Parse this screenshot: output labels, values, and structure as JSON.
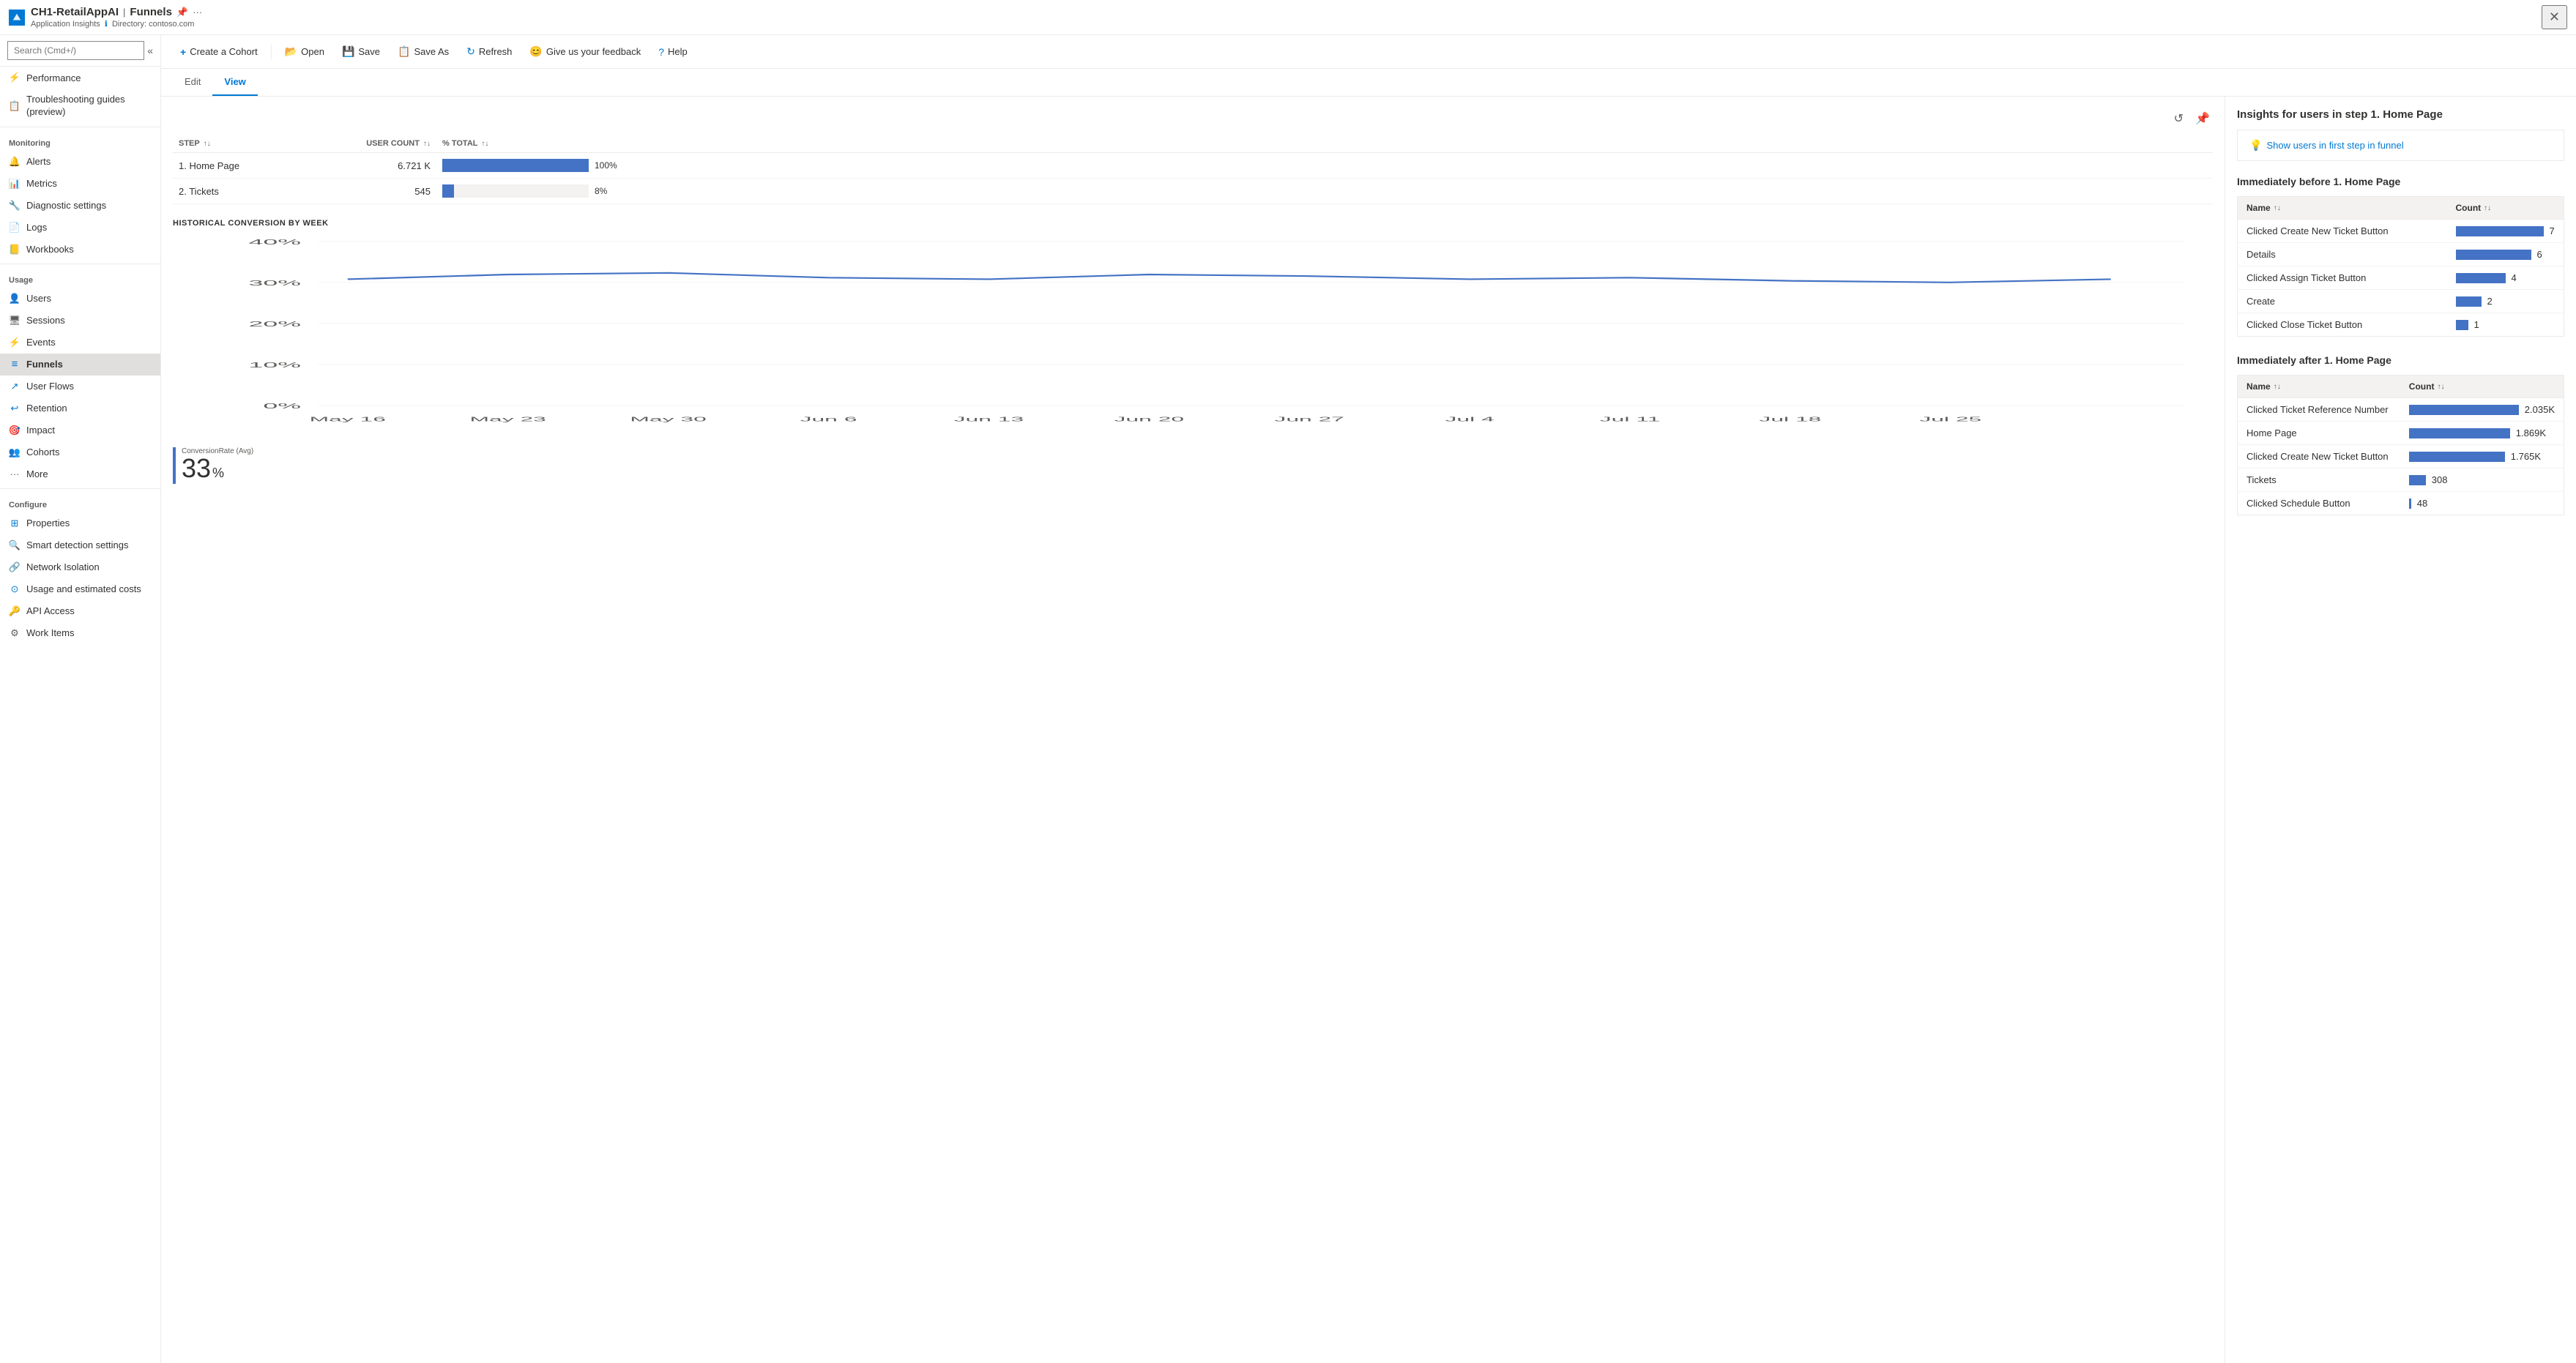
{
  "topbar": {
    "app_icon_label": "Azure",
    "title": "CH1-RetailAppAI",
    "separator": "|",
    "section": "Funnels",
    "subtitle_app": "Application Insights",
    "subtitle_dir": "Directory: contoso.com",
    "pin_icon": "📌",
    "more_icon": "···",
    "close_icon": "✕"
  },
  "toolbar": {
    "create_cohort": "Create a Cohort",
    "open": "Open",
    "save": "Save",
    "save_as": "Save As",
    "refresh": "Refresh",
    "feedback": "Give us your feedback",
    "help": "Help"
  },
  "tabs": {
    "edit": "Edit",
    "view": "View"
  },
  "sidebar": {
    "search_placeholder": "Search (Cmd+/)",
    "items_top": [
      {
        "id": "performance",
        "label": "Performance",
        "icon": "⚡"
      },
      {
        "id": "troubleshooting",
        "label": "Troubleshooting guides (preview)",
        "icon": "📋"
      }
    ],
    "section_monitoring": "Monitoring",
    "items_monitoring": [
      {
        "id": "alerts",
        "label": "Alerts",
        "icon": "🔔"
      },
      {
        "id": "metrics",
        "label": "Metrics",
        "icon": "📊"
      },
      {
        "id": "diagnostic",
        "label": "Diagnostic settings",
        "icon": "🔧"
      },
      {
        "id": "logs",
        "label": "Logs",
        "icon": "📄"
      },
      {
        "id": "workbooks",
        "label": "Workbooks",
        "icon": "📒"
      }
    ],
    "section_usage": "Usage",
    "items_usage": [
      {
        "id": "users",
        "label": "Users",
        "icon": "👤"
      },
      {
        "id": "sessions",
        "label": "Sessions",
        "icon": "🖥"
      },
      {
        "id": "events",
        "label": "Events",
        "icon": "⚡"
      },
      {
        "id": "funnels",
        "label": "Funnels",
        "icon": "≡",
        "active": true
      },
      {
        "id": "userflows",
        "label": "User Flows",
        "icon": "↗"
      },
      {
        "id": "retention",
        "label": "Retention",
        "icon": "↩"
      },
      {
        "id": "impact",
        "label": "Impact",
        "icon": "🎯"
      },
      {
        "id": "cohorts",
        "label": "Cohorts",
        "icon": "👥"
      },
      {
        "id": "more",
        "label": "More",
        "icon": "···"
      }
    ],
    "section_configure": "Configure",
    "items_configure": [
      {
        "id": "properties",
        "label": "Properties",
        "icon": "⊞"
      },
      {
        "id": "smartdetection",
        "label": "Smart detection settings",
        "icon": "🔍"
      },
      {
        "id": "networki",
        "label": "Network Isolation",
        "icon": "🔗"
      },
      {
        "id": "usagecosts",
        "label": "Usage and estimated costs",
        "icon": "⊙"
      },
      {
        "id": "apiaccess",
        "label": "API Access",
        "icon": "🔑"
      },
      {
        "id": "workitems",
        "label": "Work Items",
        "icon": "⚙"
      }
    ]
  },
  "funnel": {
    "columns": {
      "step": "STEP",
      "user_count": "USER COUNT",
      "pct_total": "% TOTAL"
    },
    "rows": [
      {
        "step": "1. Home Page",
        "user_count": "6.721 K",
        "pct_total": "100%",
        "bar_pct": 100
      },
      {
        "step": "2. Tickets",
        "user_count": "545",
        "pct_total": "8%",
        "bar_pct": 8
      }
    ]
  },
  "chart": {
    "title": "HISTORICAL CONVERSION BY WEEK",
    "y_labels": [
      "40%",
      "30%",
      "20%",
      "10%",
      "0%"
    ],
    "x_labels": [
      "May 16",
      "May 23",
      "May 30",
      "Jun 6",
      "Jun 13",
      "Jun 20",
      "Jun 27",
      "Jul 4",
      "Jul 11",
      "Jul 18",
      "Jul 25"
    ],
    "conversion_label": "ConversionRate (Avg)",
    "conversion_value": "33",
    "conversion_unit": "%"
  },
  "right_panel": {
    "insight_title": "Insights for users in step 1. Home Page",
    "insight_link": "Show users in first step in funnel",
    "before_title": "Immediately before 1. Home Page",
    "before_columns": {
      "name": "Name",
      "count": "Count"
    },
    "before_rows": [
      {
        "name": "Clicked Create New Ticket Button",
        "count": "7",
        "bar_pct": 100
      },
      {
        "name": "Details",
        "count": "6",
        "bar_pct": 86
      },
      {
        "name": "Clicked Assign Ticket Button",
        "count": "4",
        "bar_pct": 57
      },
      {
        "name": "Create",
        "count": "2",
        "bar_pct": 29
      },
      {
        "name": "Clicked Close Ticket Button",
        "count": "1",
        "bar_pct": 14
      }
    ],
    "after_title": "Immediately after 1. Home Page",
    "after_columns": {
      "name": "Name",
      "count": "Count"
    },
    "after_rows": [
      {
        "name": "Clicked Ticket Reference Number",
        "count": "2.035K",
        "bar_pct": 100
      },
      {
        "name": "Home Page",
        "count": "1.869K",
        "bar_pct": 92
      },
      {
        "name": "Clicked Create New Ticket Button",
        "count": "1.765K",
        "bar_pct": 87
      },
      {
        "name": "Tickets",
        "count": "308",
        "bar_pct": 15
      },
      {
        "name": "Clicked Schedule Button",
        "count": "48",
        "bar_pct": 2
      }
    ]
  }
}
